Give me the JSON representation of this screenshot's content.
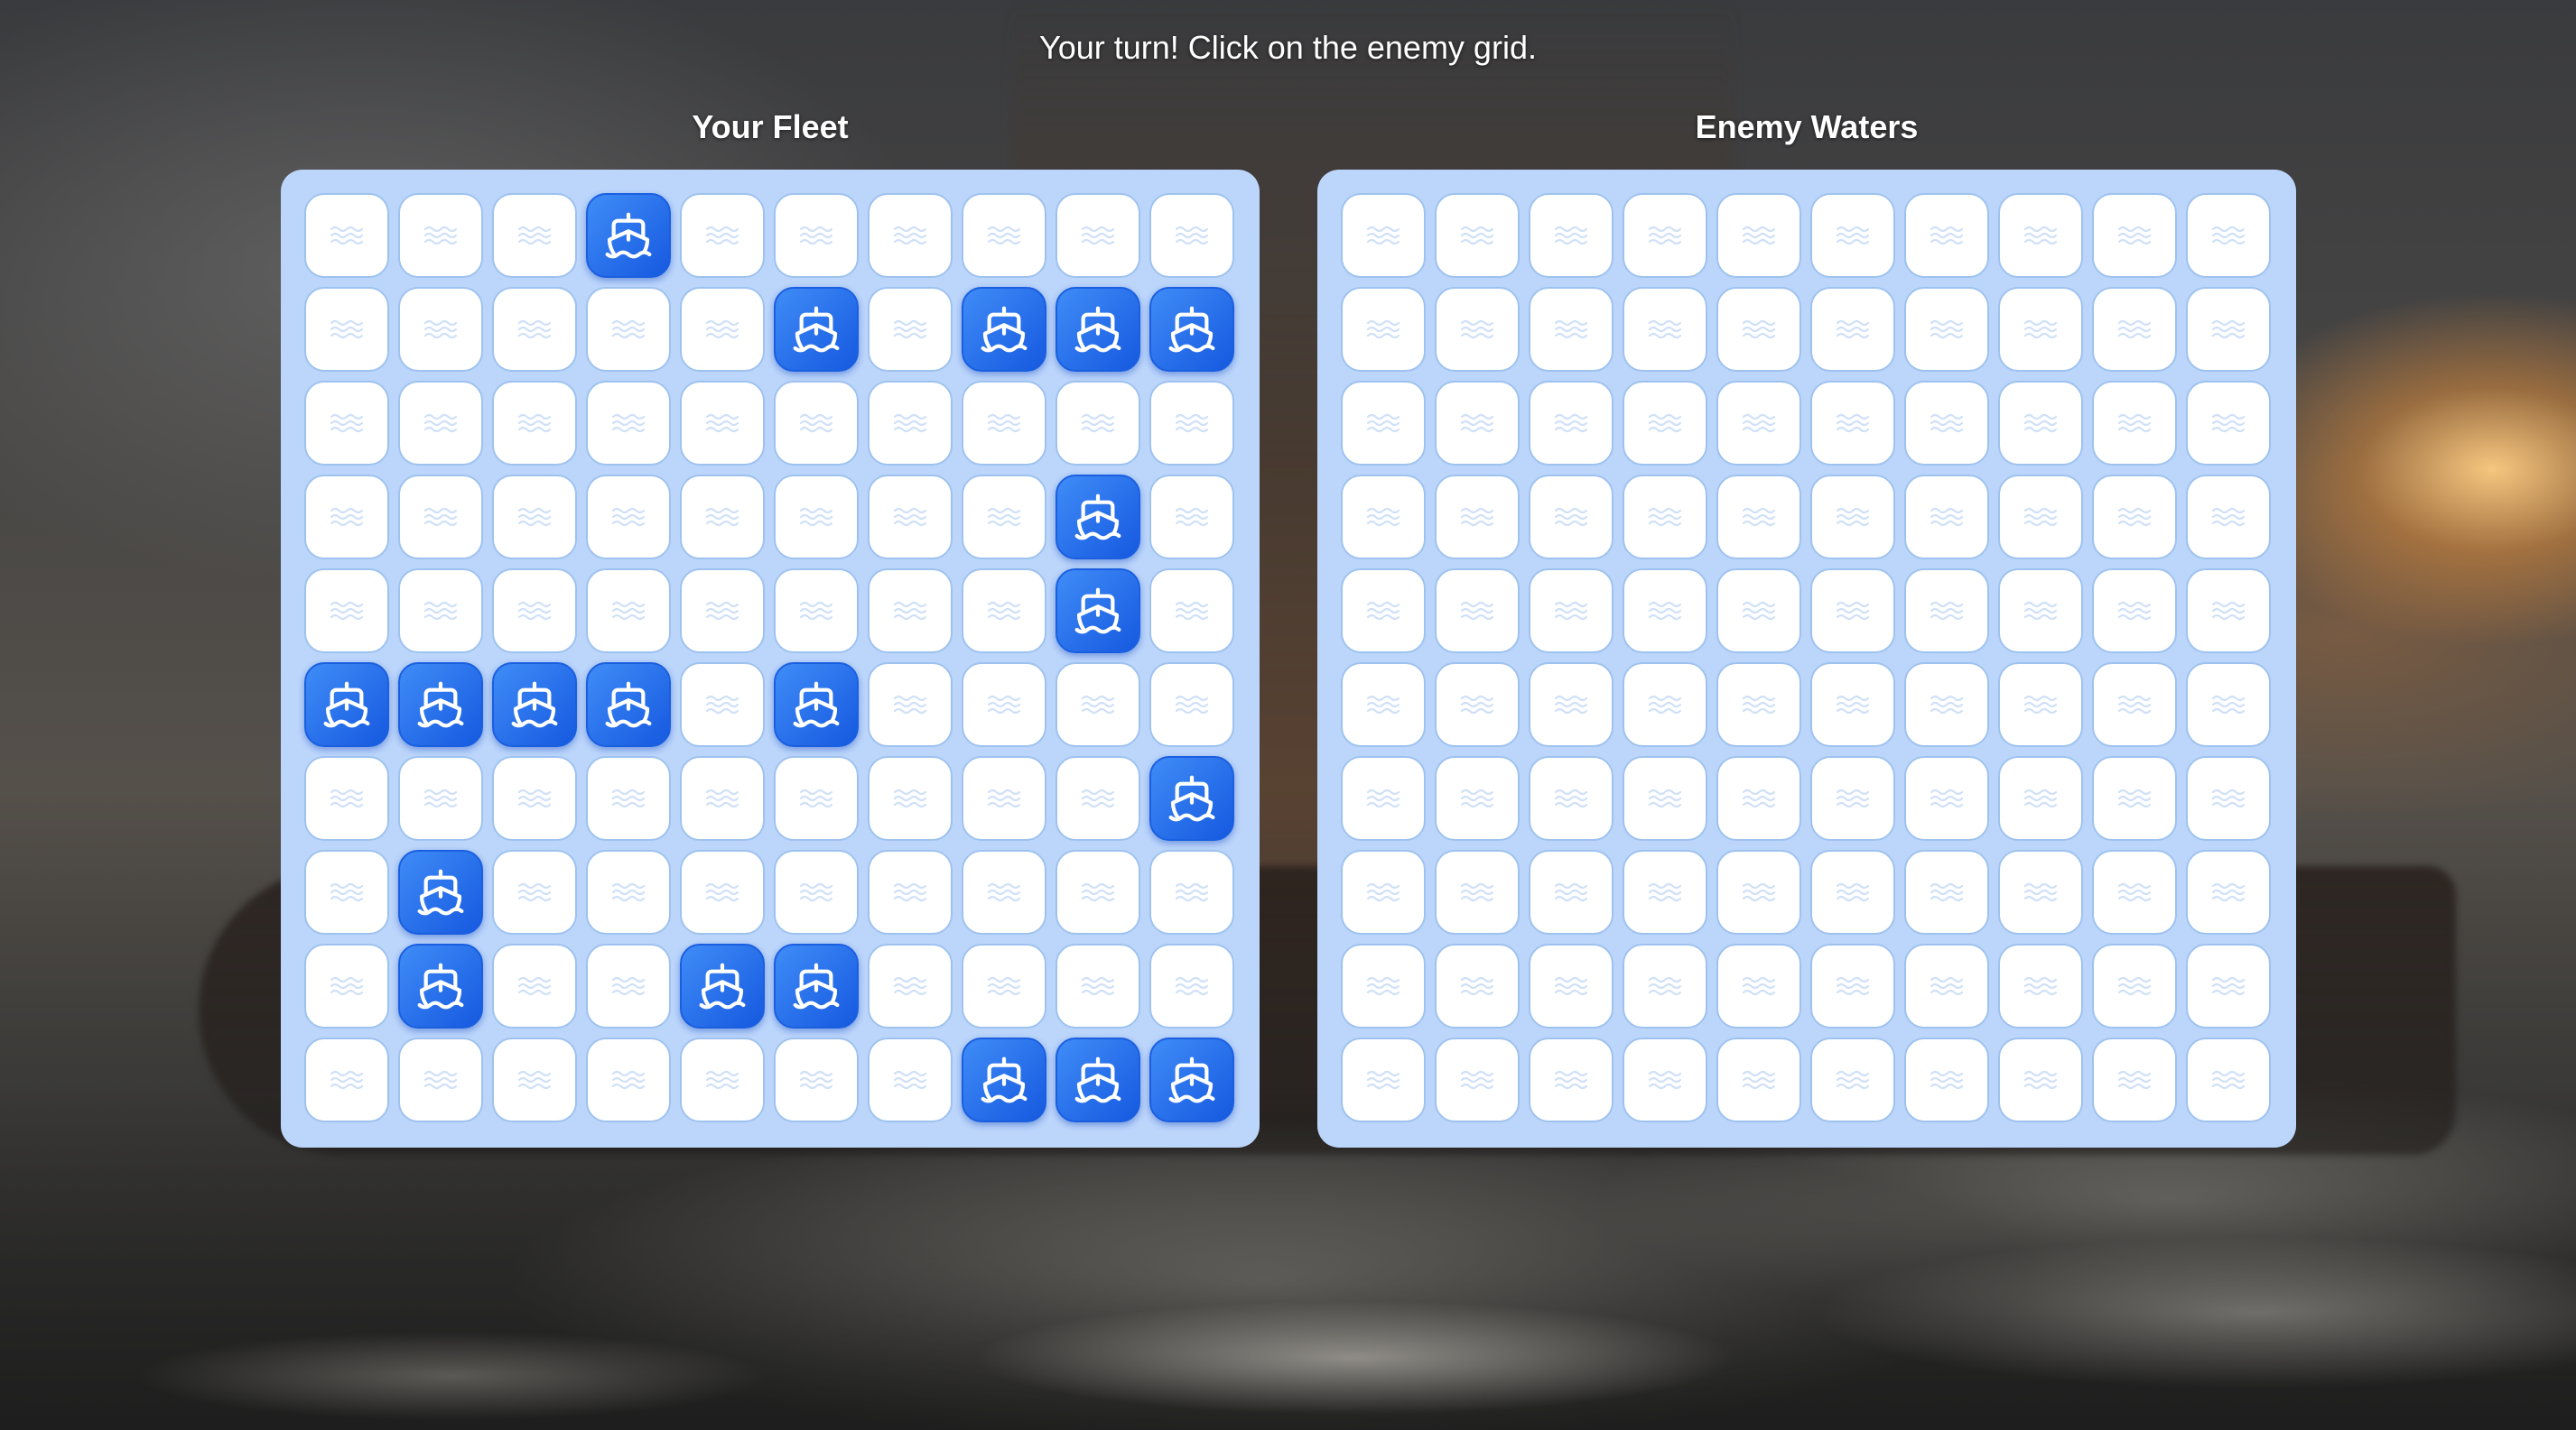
{
  "status_text": "Your turn! Click on the enemy grid.",
  "player_board": {
    "title": "Your Fleet",
    "rows": [
      [
        0,
        0,
        0,
        1,
        0,
        0,
        0,
        0,
        0,
        0
      ],
      [
        0,
        0,
        0,
        0,
        0,
        1,
        0,
        1,
        1,
        1
      ],
      [
        0,
        0,
        0,
        0,
        0,
        0,
        0,
        0,
        0,
        0
      ],
      [
        0,
        0,
        0,
        0,
        0,
        0,
        0,
        0,
        1,
        0
      ],
      [
        0,
        0,
        0,
        0,
        0,
        0,
        0,
        0,
        1,
        0
      ],
      [
        1,
        1,
        1,
        1,
        0,
        1,
        0,
        0,
        0,
        0
      ],
      [
        0,
        0,
        0,
        0,
        0,
        0,
        0,
        0,
        0,
        1
      ],
      [
        0,
        1,
        0,
        0,
        0,
        0,
        0,
        0,
        0,
        0
      ],
      [
        0,
        1,
        0,
        0,
        1,
        1,
        0,
        0,
        0,
        0
      ],
      [
        0,
        0,
        0,
        0,
        0,
        0,
        0,
        1,
        1,
        1
      ]
    ]
  },
  "enemy_board": {
    "title": "Enemy Waters",
    "rows": [
      [
        0,
        0,
        0,
        0,
        0,
        0,
        0,
        0,
        0,
        0
      ],
      [
        0,
        0,
        0,
        0,
        0,
        0,
        0,
        0,
        0,
        0
      ],
      [
        0,
        0,
        0,
        0,
        0,
        0,
        0,
        0,
        0,
        0
      ],
      [
        0,
        0,
        0,
        0,
        0,
        0,
        0,
        0,
        0,
        0
      ],
      [
        0,
        0,
        0,
        0,
        0,
        0,
        0,
        0,
        0,
        0
      ],
      [
        0,
        0,
        0,
        0,
        0,
        0,
        0,
        0,
        0,
        0
      ],
      [
        0,
        0,
        0,
        0,
        0,
        0,
        0,
        0,
        0,
        0
      ],
      [
        0,
        0,
        0,
        0,
        0,
        0,
        0,
        0,
        0,
        0
      ],
      [
        0,
        0,
        0,
        0,
        0,
        0,
        0,
        0,
        0,
        0
      ],
      [
        0,
        0,
        0,
        0,
        0,
        0,
        0,
        0,
        0,
        0
      ]
    ]
  },
  "legend": {
    "water_icon": "waves-icon",
    "ship_icon": "ship-icon"
  },
  "colors": {
    "board_bg": "#bcd6fb",
    "cell_border": "#9ec2ef",
    "ship_fill": "#1f6bee",
    "water_icon": "#cfe0f7"
  }
}
